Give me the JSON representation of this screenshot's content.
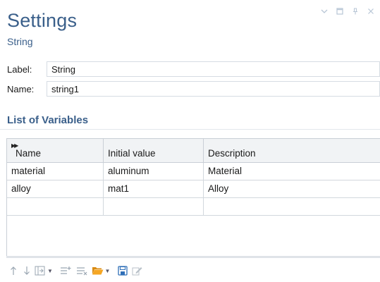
{
  "panel": {
    "title": "Settings",
    "subtitle": "String"
  },
  "window_controls": {
    "collapse_icon": "chevron-down-icon",
    "maximize_icon": "maximize-icon",
    "pin_icon": "pin-icon",
    "close_icon": "close-icon"
  },
  "fields": {
    "label_caption": "Label:",
    "label_value": "String",
    "name_caption": "Name:",
    "name_value": "string1"
  },
  "variables": {
    "section_title": "List of Variables",
    "columns": [
      "Name",
      "Initial value",
      "Description"
    ],
    "rows": [
      [
        "material",
        "aluminum",
        "Material"
      ],
      [
        "alloy",
        "mat1",
        "Alloy"
      ],
      [
        "",
        "",
        ""
      ]
    ]
  },
  "toolbar": {
    "buttons": [
      "move-up-icon",
      "move-down-icon",
      "add-row-icon",
      "insert-icon",
      "delete-icon",
      "open-folder-icon",
      "save-icon",
      "clear-icon"
    ]
  },
  "colors": {
    "title": "#3a5f8a",
    "accent_folder": "#f5a623",
    "save_icon": "#2f6fb8"
  }
}
